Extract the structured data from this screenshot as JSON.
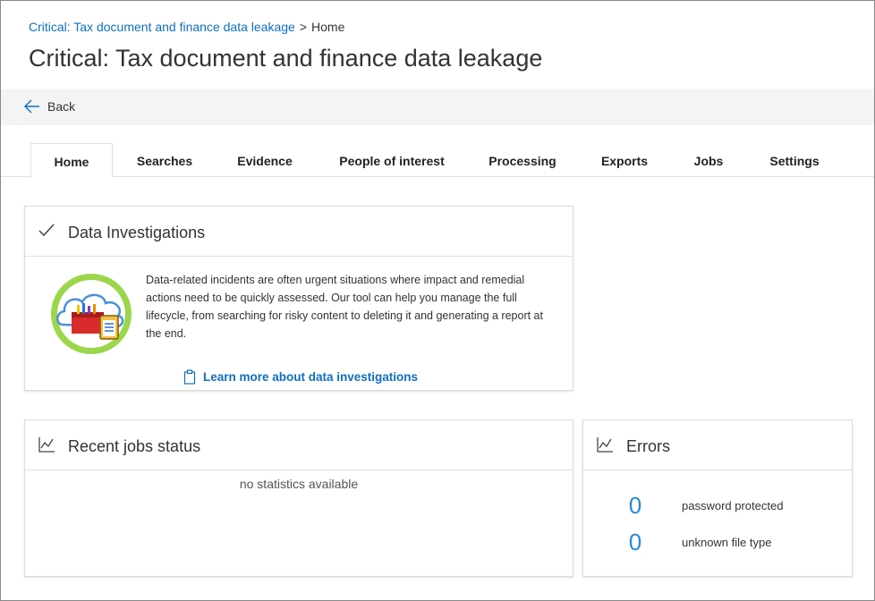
{
  "breadcrumb": {
    "case_link": "Critical: Tax document and finance data leakage",
    "separator": ">",
    "current": "Home"
  },
  "page_title": "Critical: Tax document and finance data leakage",
  "back": {
    "label": "Back",
    "icon": "arrow-left-icon"
  },
  "tabs": [
    {
      "label": "Home",
      "active": true
    },
    {
      "label": "Searches"
    },
    {
      "label": "Evidence"
    },
    {
      "label": "People of interest"
    },
    {
      "label": "Processing"
    },
    {
      "label": "Exports"
    },
    {
      "label": "Jobs"
    },
    {
      "label": "Settings"
    }
  ],
  "intro_card": {
    "title": "Data Investigations",
    "icon": "checkmark-icon",
    "description": "Data-related incidents are often urgent situations where impact and remedial actions need to be quickly assessed. Our tool can help you manage the full lifecycle, from searching for risky content to deleting it and generating a report at the end.",
    "link_label": "Learn more about data investigations",
    "link_icon": "clipboard-icon"
  },
  "jobs_card": {
    "title": "Recent jobs status",
    "icon": "line-chart-icon",
    "empty_text": "no statistics available"
  },
  "errors_card": {
    "title": "Errors",
    "icon": "line-chart-icon",
    "rows": [
      {
        "count": "0",
        "label": "password protected"
      },
      {
        "count": "0",
        "label": "unknown file type"
      }
    ]
  },
  "colors": {
    "link": "#106ebe",
    "count": "#2b88d8",
    "backbar": "#f4f4f4"
  }
}
